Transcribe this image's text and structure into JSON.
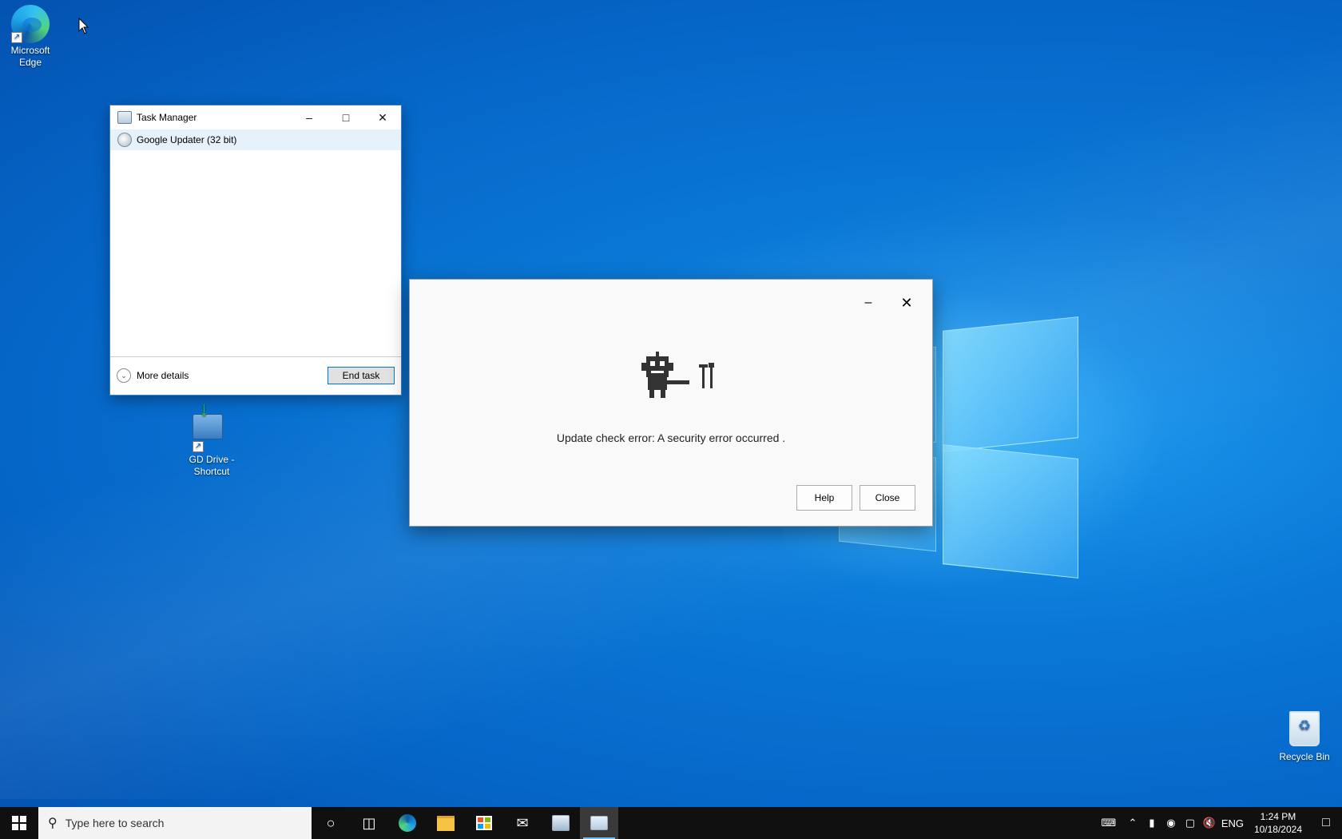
{
  "desktop": {
    "icons": [
      {
        "label": "Microsoft Edge"
      },
      {
        "label": "GD Drive - Shortcut"
      },
      {
        "label": "Recycle Bin"
      }
    ]
  },
  "task_manager": {
    "title": "Task Manager",
    "process": "Google Updater (32 bit)",
    "more_details": "More details",
    "end_task": "End task",
    "controls": {
      "minimize": "–",
      "maximize": "□",
      "close": "✕"
    }
  },
  "updater_dialog": {
    "message": "Update check error: A security error occurred .",
    "help_label": "Help",
    "close_label": "Close",
    "controls": {
      "minimize": "–",
      "close": "✕"
    }
  },
  "taskbar": {
    "search_placeholder": "Type here to search",
    "language": "ENG",
    "time": "1:24 PM",
    "date": "10/18/2024",
    "apps": [
      "cortana-icon",
      "task-view-icon",
      "edge-icon",
      "file-explorer-icon",
      "store-icon",
      "mail-icon",
      "updater-icon",
      "task-manager-icon"
    ]
  }
}
